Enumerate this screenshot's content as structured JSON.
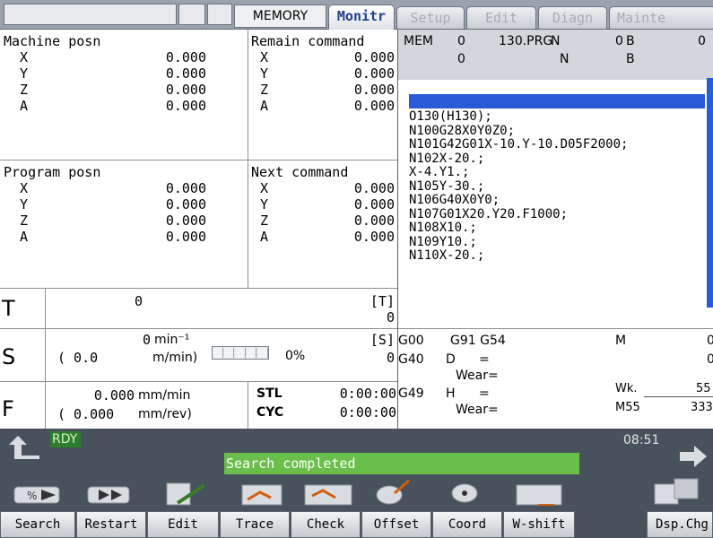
{
  "topbar": {
    "mode": "MEMORY",
    "tabs": [
      "Monitr",
      "Setup",
      "Edit",
      "Diagn",
      "Mainte"
    ]
  },
  "machine_posn": {
    "title": "Machine posn",
    "axes": [
      {
        "axis": "X",
        "value": "0.000"
      },
      {
        "axis": "Y",
        "value": "0.000"
      },
      {
        "axis": "Z",
        "value": "0.000"
      },
      {
        "axis": "A",
        "value": "0.000"
      }
    ]
  },
  "remain_command": {
    "title": "Remain command",
    "axes": [
      {
        "axis": "X",
        "value": "0.000"
      },
      {
        "axis": "Y",
        "value": "0.000"
      },
      {
        "axis": "Z",
        "value": "0.000"
      },
      {
        "axis": "A",
        "value": "0.000"
      }
    ]
  },
  "program_posn": {
    "title": "Program posn",
    "axes": [
      {
        "axis": "X",
        "value": "0.000"
      },
      {
        "axis": "Y",
        "value": "0.000"
      },
      {
        "axis": "Z",
        "value": "0.000"
      },
      {
        "axis": "A",
        "value": "0.000"
      }
    ]
  },
  "next_command": {
    "title": "Next command",
    "axes": [
      {
        "axis": "X",
        "value": "0.000"
      },
      {
        "axis": "Y",
        "value": "0.000"
      },
      {
        "axis": "Z",
        "value": "0.000"
      },
      {
        "axis": "A",
        "value": "0.000"
      }
    ]
  },
  "program_header": {
    "mem": "MEM",
    "o1": "0",
    "o2": "0",
    "file": "130.PRG",
    "n_label": "N",
    "n1": "0",
    "n2": "",
    "b_label": "B",
    "b1": "0",
    "b2": ""
  },
  "program_lines": [
    "",
    "O130(H130);",
    "N100G28X0Y0Z0;",
    "N101G42G01X-10.Y-10.D05F2000;",
    "N102X-20.;",
    "X-4.Y1.;",
    "N105Y-30.;",
    "N106G40X0Y0;",
    "N107G01X20.Y20.F1000;",
    "N108X10.;",
    "N109Y10.;",
    "N110X-20.;"
  ],
  "t_section": {
    "label": "T",
    "value": "0",
    "bracket": "[T]",
    "sub": "0"
  },
  "s_section": {
    "label": "S",
    "speed": "0",
    "speed_unit": "min⁻¹",
    "surface": "( 0.0",
    "surface_unit": "m/min)",
    "load_percent": "0%",
    "bracket": "[S]",
    "sub": "0",
    "load_level": 0
  },
  "f_section": {
    "label": "F",
    "feed": "0.000",
    "feed_unit": "mm/min",
    "per_rev": "( 0.000",
    "per_rev_unit": "mm/rev)",
    "stl_label": "STL",
    "stl_time": "0:00:00",
    "cyc_label": "CYC",
    "cyc_time": "0:00:00"
  },
  "modal": {
    "g1": "G00",
    "g2": "G91 G54",
    "g3": "G40",
    "d_label": "D",
    "d_eq": "=",
    "wear1": "Wear=",
    "g4": "G49",
    "h_label": "H",
    "h_eq": "=",
    "wear2": "Wear=",
    "m_label": "M",
    "m_val1": "0",
    "m_val2": "0",
    "wk_label": "Wk.",
    "wk_val": "55",
    "m55_label": "M55",
    "m55_val": "333"
  },
  "status": {
    "rdy": "RDY",
    "message": "Search completed",
    "time": "08:51"
  },
  "softkeys": [
    "Search",
    "Restart",
    "Edit",
    "Trace",
    "Check",
    "Offset",
    "Coord",
    "W-shift",
    "",
    "Dsp.Chg"
  ],
  "colors": {
    "accent_blue": "#1f3f8a",
    "highlight_bar": "#2a5bd7",
    "status_green": "#6abf4b",
    "bottom_bg": "#48525c"
  }
}
